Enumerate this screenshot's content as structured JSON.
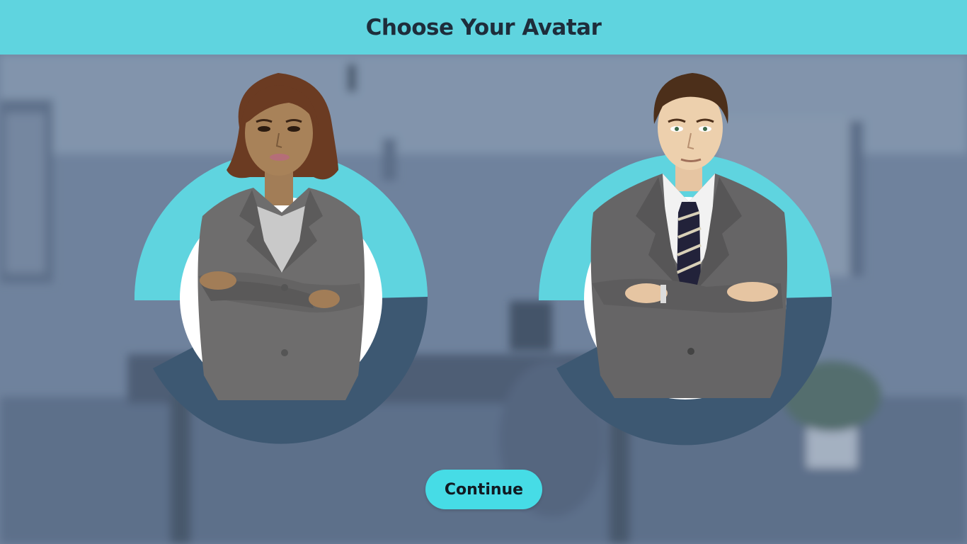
{
  "header": {
    "title": "Choose Your Avatar"
  },
  "avatars": [
    {
      "label": "female-avatar"
    },
    {
      "label": "male-avatar"
    }
  ],
  "actions": {
    "continue_label": "Continue"
  },
  "colors": {
    "header_bg": "#5fd4df",
    "ring_light": "#5fd4df",
    "ring_dark": "#3d5872",
    "button_bg": "#46dce6",
    "title_text": "#1e2d3b",
    "overlay": "#5f7390"
  }
}
